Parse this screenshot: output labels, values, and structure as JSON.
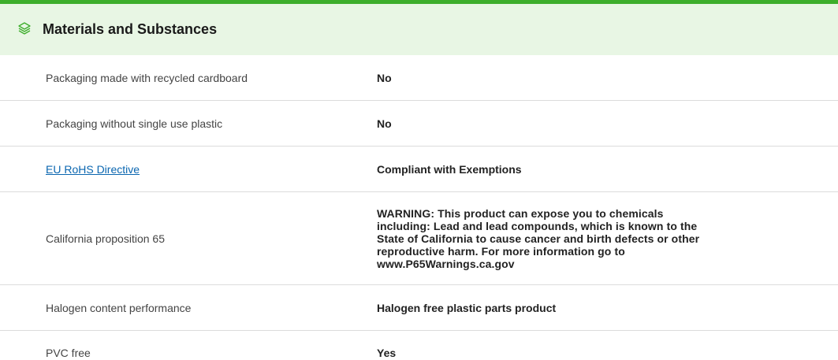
{
  "section": {
    "title": "Materials and Substances",
    "icon": "layers-icon",
    "accent_color": "#3dae2b",
    "header_bg": "#e8f6e4"
  },
  "rows": [
    {
      "label": "Packaging made with recycled cardboard",
      "value": "No"
    },
    {
      "label": "Packaging without single use plastic",
      "value": "No"
    },
    {
      "label": "EU RoHS Directive",
      "value": "Compliant with Exemptions",
      "label_is_link": true
    },
    {
      "label": "California proposition 65",
      "value": "WARNING: This product can expose you to chemicals including: Lead and lead compounds, which is known to the State of California to cause cancer and birth defects or other reproductive harm. For more information go to www.P65Warnings.ca.gov"
    },
    {
      "label": "Halogen content performance",
      "value": "Halogen free plastic parts product"
    },
    {
      "label": "PVC free",
      "value": "Yes"
    }
  ]
}
